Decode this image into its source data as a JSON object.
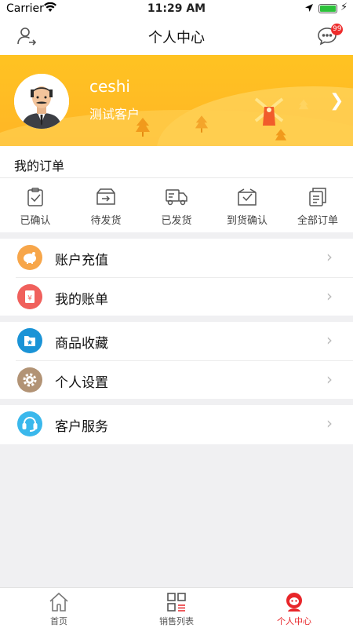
{
  "status_bar": {
    "carrier": "Carrier",
    "time": "11:29 AM"
  },
  "nav": {
    "title": "个人中心",
    "badge": "99"
  },
  "profile": {
    "username": "ceshi",
    "user_type": "测试客户"
  },
  "orders": {
    "header": "我的订单",
    "items": [
      {
        "label": "已确认",
        "icon": "confirmed-icon"
      },
      {
        "label": "待发货",
        "icon": "pending-shipment-icon"
      },
      {
        "label": "已发货",
        "icon": "shipped-truck-icon"
      },
      {
        "label": "到货确认",
        "icon": "delivery-confirm-icon"
      },
      {
        "label": "全部订单",
        "icon": "all-orders-icon"
      }
    ]
  },
  "menu": {
    "group1": [
      {
        "label": "账户充值",
        "icon": "piggy-bank-icon",
        "color": "#f7a64a"
      },
      {
        "label": "我的账单",
        "icon": "bill-icon",
        "color": "#f0605c"
      }
    ],
    "group2": [
      {
        "label": "商品收藏",
        "icon": "favorite-folder-icon",
        "color": "#1a93d6"
      },
      {
        "label": "个人设置",
        "icon": "gear-icon",
        "color": "#b29375"
      }
    ],
    "group3": [
      {
        "label": "客户服务",
        "icon": "headset-icon",
        "color": "#3ab8ec"
      }
    ]
  },
  "tabbar": {
    "items": [
      {
        "label": "首页",
        "icon": "home-icon"
      },
      {
        "label": "销售列表",
        "icon": "sales-list-icon"
      },
      {
        "label": "个人中心",
        "icon": "profile-icon",
        "active": true
      }
    ]
  },
  "colors": {
    "accent": "#e8262a",
    "banner": "#ffbb26"
  }
}
